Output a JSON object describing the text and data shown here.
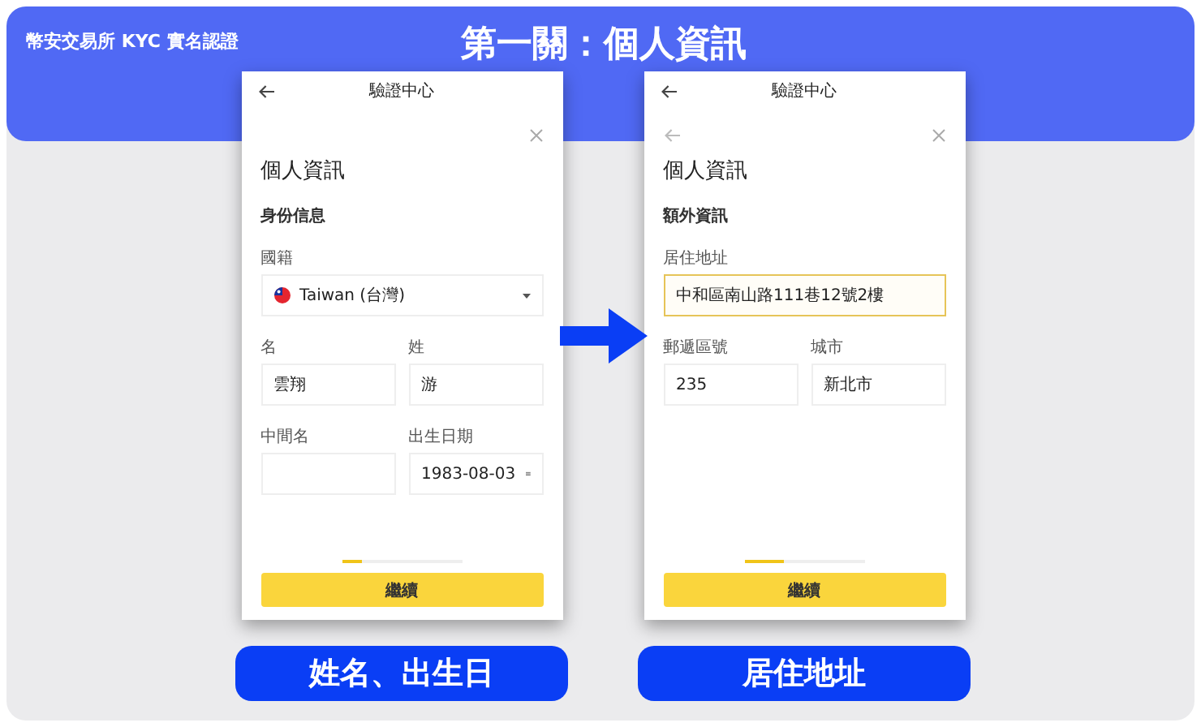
{
  "header": {
    "brand": "幣安交易所 KYC 實名認證",
    "title": "第一關：個人資訊"
  },
  "screens": [
    {
      "top_title": "驗證中心",
      "inner_back": false,
      "heading": "個人資訊",
      "section": "身份信息",
      "rows": [
        [
          {
            "kind": "select",
            "label": "國籍",
            "value": "Taiwan (台灣)",
            "focused": false
          }
        ],
        [
          {
            "kind": "text",
            "label": "名",
            "value": "雲翔",
            "focused": false
          },
          {
            "kind": "text",
            "label": "姓",
            "value": "游",
            "focused": false
          }
        ],
        [
          {
            "kind": "text",
            "label": "中間名",
            "focused": false
          },
          {
            "kind": "date",
            "label": "出生日期",
            "value": "1983-08-03",
            "focused": false
          }
        ]
      ],
      "progress": {
        "level": 0.17
      },
      "button": "繼續",
      "caption": "姓名、出生日"
    },
    {
      "top_title": "驗證中心",
      "inner_back": true,
      "heading": "個人資訊",
      "section": "額外資訊",
      "rows": [
        [
          {
            "kind": "text",
            "label": "居住地址",
            "value": "中和區南山路111巷12號2樓",
            "focused": true
          }
        ],
        [
          {
            "kind": "text",
            "label": "郵遞區號",
            "value": "235",
            "focused": false
          },
          {
            "kind": "text",
            "label": "城市",
            "value": "新北市",
            "focused": false
          }
        ]
      ],
      "progress": {
        "level": 0.33
      },
      "button": "繼續",
      "caption": "居住地址"
    }
  ]
}
